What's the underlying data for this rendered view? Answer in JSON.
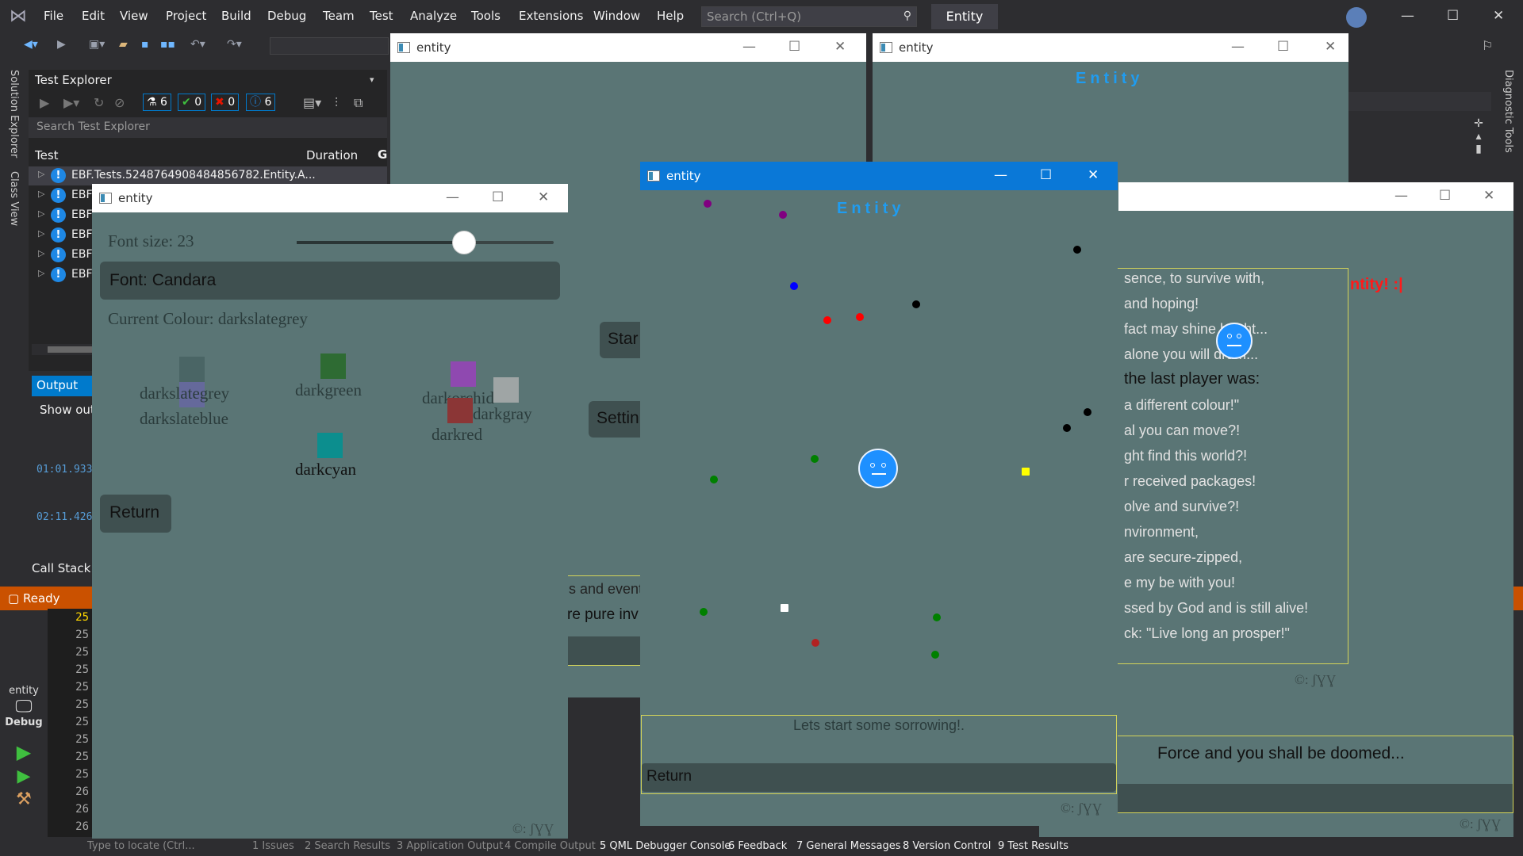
{
  "vs": {
    "menu": [
      "File",
      "Edit",
      "View",
      "Project",
      "Build",
      "Debug",
      "Team",
      "Test",
      "Analyze",
      "Tools",
      "Extensions",
      "Window",
      "Help"
    ],
    "search_placeholder": "Search (Ctrl+Q)",
    "solution_name": "Entity",
    "left_tabs": [
      "Solution Explorer",
      "Class View"
    ],
    "right_tabs": [
      "Diagnostic Tools"
    ],
    "test_explorer": {
      "title": "Test Explorer",
      "badges": {
        "total": "6",
        "passed": "0",
        "failed": "0",
        "not_run": "6"
      },
      "search_placeholder": "Search Test Explorer",
      "col_test": "Test",
      "col_duration": "Duration",
      "col_g": "G",
      "rows": [
        "EBF.Tests.5248764908484856782.Entity.A...",
        "EBF",
        "EBF",
        "EBF",
        "EBF",
        "EBF"
      ]
    },
    "output": {
      "tab": "Output",
      "show_output": "Show outpu",
      "timestamps": [
        "01:01.933",
        "02:11.426"
      ]
    },
    "call_stack": "Call Stack",
    "status": "Ready",
    "line_numbers": [
      "25",
      "25",
      "25",
      "25",
      "25",
      "25",
      "25",
      "25",
      "25",
      "25",
      "26",
      "26",
      "26"
    ],
    "debug_target": {
      "project": "entity",
      "mode": "Debug"
    },
    "bottom_tabs": [
      "Type to locate (Ctrl...",
      "1 Issues",
      "2 Search Results",
      "3 Application Output",
      "4 Compile Output",
      "5 QML Debugger Console",
      "6 Feedback",
      "7 General Messages",
      "8 Version Control",
      "9 Test Results"
    ]
  },
  "windows": {
    "title": "entity",
    "game": {
      "heading": "Entity",
      "message": "Lets start some sorrowing!.",
      "return_label": "Return",
      "copyright": "©: ʃƔƔ",
      "colors": {
        "purple": "#800080",
        "blue": "#0000ff",
        "red": "#ff0000",
        "black": "#000000",
        "green": "#008000",
        "yellow": "#ffff00",
        "white": "#ffffff",
        "darkred": "#b22222",
        "player": "#1e90ff"
      }
    },
    "settings": {
      "font_size_label": "Font size: 23",
      "font_size_value": 23,
      "font_label": "Font: Candara",
      "current_colour": "Current Colour: darkslategrey",
      "return_label": "Return",
      "copyright": "©: ʃƔƔ",
      "swatches": [
        {
          "name": "darkslategrey",
          "color": "#4a6565"
        },
        {
          "name": "darkslateblue",
          "color": "#6a66a8"
        },
        {
          "name": "darkgreen",
          "color": "#2e6b33"
        },
        {
          "name": "darkorchid",
          "color": "#8f49b0"
        },
        {
          "name": "darkgray",
          "color": "#9fa5a5"
        },
        {
          "name": "darkred",
          "color": "#8b3636"
        },
        {
          "name": "darkcyan",
          "color": "#0c8e8e"
        }
      ]
    },
    "menu_window": {
      "start_partial": "Star",
      "settings_partial": "Settin",
      "partial_line1": "s and event",
      "partial_line2": "re pure inv"
    },
    "story": {
      "heading": "Entity",
      "red_partial": "ntity! :|",
      "lines": [
        "sence, to survive with,",
        "and hoping!",
        "fact may shine bright...",
        "alone you will drum...",
        "the last player was:",
        "a different colour!\"",
        "al you can move?!",
        "ght find this world?!",
        "r received packages!",
        "olve and survive?!",
        "nvironment,",
        "are secure-zipped,",
        "e my be with you!",
        "ssed by God and is still alive!",
        "ck: \"Live long an prosper!\""
      ],
      "copyright": "©: ʃƔƔ"
    },
    "back_window": {
      "message": "Force and you shall be doomed...",
      "copyright": "©: ʃƔƔ"
    }
  }
}
